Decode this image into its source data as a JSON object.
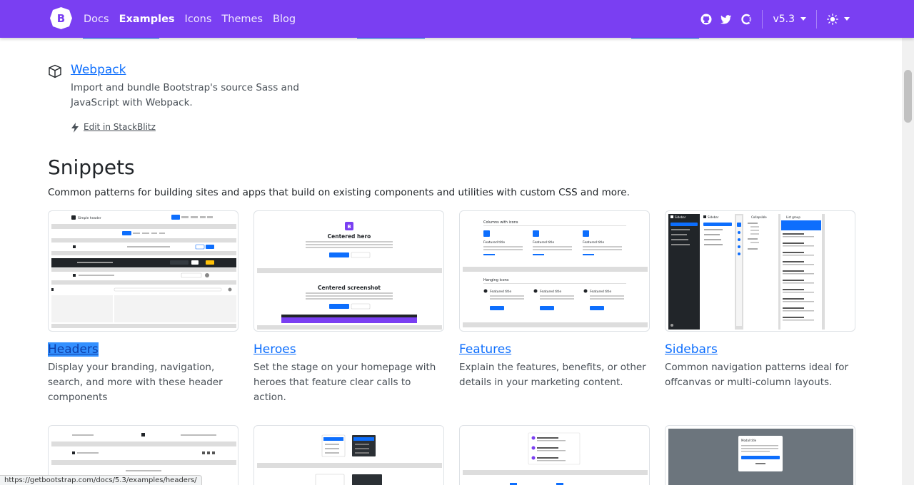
{
  "navbar": {
    "brand_letter": "B",
    "links": [
      "Docs",
      "Examples",
      "Icons",
      "Themes",
      "Blog"
    ],
    "active": "Examples",
    "icons": [
      "github-icon",
      "twitter-icon",
      "opencollective-icon"
    ],
    "version": "v5.3",
    "theme_icon": "sun-icon",
    "color": "#7a3ff2"
  },
  "webpack": {
    "title": "Webpack",
    "desc": "Import and bundle Bootstrap's source Sass and JavaScript with Webpack.",
    "stackblitz": "Edit in StackBlitz"
  },
  "snippets": {
    "heading": "Snippets",
    "lead": "Common patterns for building sites and apps that build on existing components and utilities with custom CSS and more.",
    "cards": [
      {
        "title": "Headers",
        "desc": "Display your branding, navigation, search, and more with these header components"
      },
      {
        "title": "Heroes",
        "desc": "Set the stage on your homepage with heroes that feature clear calls to action."
      },
      {
        "title": "Features",
        "desc": "Explain the features, benefits, or other details in your marketing content."
      },
      {
        "title": "Sidebars",
        "desc": "Common navigation patterns ideal for offcanvas or multi-column layouts."
      }
    ]
  },
  "thumbs": {
    "headers_label": "Simple header",
    "hero1": "Centered hero",
    "hero2": "Centered screenshot",
    "features_cols": "Columns with icons",
    "features_hanging": "Hanging icons",
    "feature_item": "Featured title",
    "sidebar_label": "Sidebar",
    "collapsible": "Collapsible",
    "list_group": "List group",
    "modal_title": "Modal title"
  },
  "status_url": "https://getbootstrap.com/docs/5.3/examples/headers/"
}
